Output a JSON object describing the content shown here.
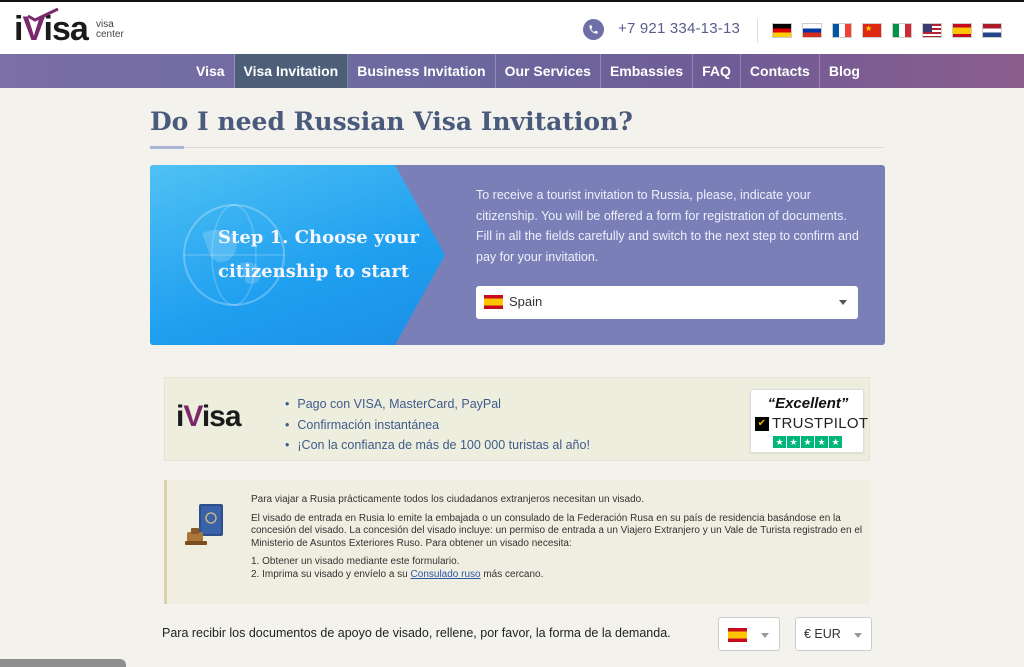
{
  "header": {
    "logo": {
      "main": "iVisa",
      "sub": "visa center"
    },
    "phone": "+7 921 334-13-13",
    "languages": [
      {
        "code": "de",
        "icon": "flag-germany-icon"
      },
      {
        "code": "ru",
        "icon": "flag-russia-icon"
      },
      {
        "code": "fr",
        "icon": "flag-france-icon"
      },
      {
        "code": "cn",
        "icon": "flag-china-icon"
      },
      {
        "code": "it",
        "icon": "flag-italy-icon"
      },
      {
        "code": "us",
        "icon": "flag-usa-icon"
      },
      {
        "code": "es",
        "icon": "flag-spain-icon"
      },
      {
        "code": "nl",
        "icon": "flag-netherlands-icon"
      }
    ]
  },
  "nav": {
    "items": [
      {
        "label": "Visa",
        "active": false
      },
      {
        "label": "Visa Invitation",
        "active": true
      },
      {
        "label": "Business Invitation",
        "active": false
      },
      {
        "label": "Our Services",
        "active": false
      },
      {
        "label": "Embassies",
        "active": false
      },
      {
        "label": "FAQ",
        "active": false
      },
      {
        "label": "Contacts",
        "active": false
      },
      {
        "label": "Blog",
        "active": false
      }
    ]
  },
  "page": {
    "title": "Do I need Russian Visa Invitation?"
  },
  "step": {
    "heading": "Step 1. Choose your citizenship to start",
    "description": "To receive a tourist invitation to Russia, please, indicate your citizenship. You will be offered a form for registration of documents. Fill in all the fields carefully and switch to the next step to confirm and pay for your invitation.",
    "citizenship": {
      "selected": "Spain",
      "flag": "flag-spain-icon"
    }
  },
  "promo": {
    "logo": "iVisa",
    "bullets": [
      "Pago con VISA, MasterCard, PayPal",
      "Confirmación instantánea",
      "¡Con la confianza de más de 100 000 turistas al año!"
    ],
    "trustpilot": {
      "rating_word": "“Excellent”",
      "brand": "TRUSTPILOT",
      "stars": 5
    }
  },
  "info": {
    "p1": "Para viajar a Rusia prácticamente todos los ciudadanos extranjeros necesitan un visado.",
    "p2": "El visado de entrada en Rusia lo emite la embajada o un consulado de la Federación Rusa en su país de residencia basándose en la concesión del visado. La concesión del visado incluye: un permiso de entrada a un Viajero Extranjero y un Vale de Turista registrado en el Ministerio de Asuntos Exteriores Ruso. Para obtener un visado necesita:",
    "step1": "1. Obtener un visado mediante este formulario.",
    "step2_prefix": "2. Imprima su visado y envíelo a su ",
    "step2_link": "Consulado ruso",
    "step2_suffix": " más cercano."
  },
  "form": {
    "prompt": "Para recibir los documentos de apoyo de visado, rellene, por favor, la forma de la demanda.",
    "country_flag": "flag-spain-icon",
    "currency": "€ EUR"
  },
  "colors": {
    "nav_active": "#4d5e78",
    "title": "#4a5a7c",
    "step_panel": "#7a7fb8",
    "step_left": "#1f9ff0",
    "link": "#2a55a8",
    "trustpilot_green": "#00b67a"
  }
}
